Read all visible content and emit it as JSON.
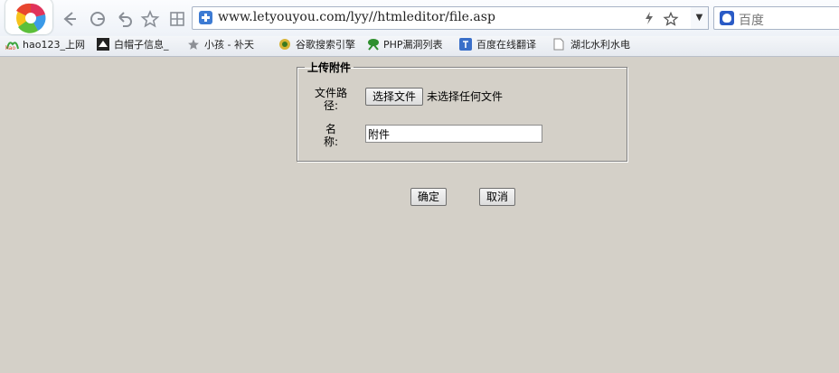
{
  "browser": {
    "url": "www.letyouyou.com/lyy//htmleditor/file.asp",
    "search_engine": "百度",
    "icons": {
      "back": "back-arrow-icon",
      "forward": "forward-arrow-icon",
      "reload": "reload-icon",
      "undo": "undo-close-tab-icon",
      "favorite": "star-icon",
      "apps": "apps-grid-icon"
    },
    "bookmarks": [
      {
        "label": "hao123_上网",
        "icon": "hao123-icon"
      },
      {
        "label": "白帽子信息_",
        "icon": "whitehat-icon"
      },
      {
        "label": "小孩 - 补天",
        "icon": "star-outline-icon"
      },
      {
        "label": "谷歌搜索引擎",
        "icon": "google-search-icon"
      },
      {
        "label": "PHP漏洞列表",
        "icon": "php-icon"
      },
      {
        "label": "百度在线翻译",
        "icon": "translate-icon"
      },
      {
        "label": "湖北水利水电",
        "icon": "page-icon"
      }
    ]
  },
  "form": {
    "legend": "上传附件",
    "path_label_line1": "文件路",
    "path_label_line2": "径:",
    "choose_file_button": "选择文件",
    "no_file_text": "未选择任何文件",
    "name_label_line1": "名",
    "name_label_line2": "称:",
    "name_value": "附件"
  },
  "actions": {
    "ok_label": "确定",
    "cancel_label": "取消"
  },
  "colors": {
    "page_background": "#d4d0c8",
    "url_shield": "#3d7bd3"
  }
}
